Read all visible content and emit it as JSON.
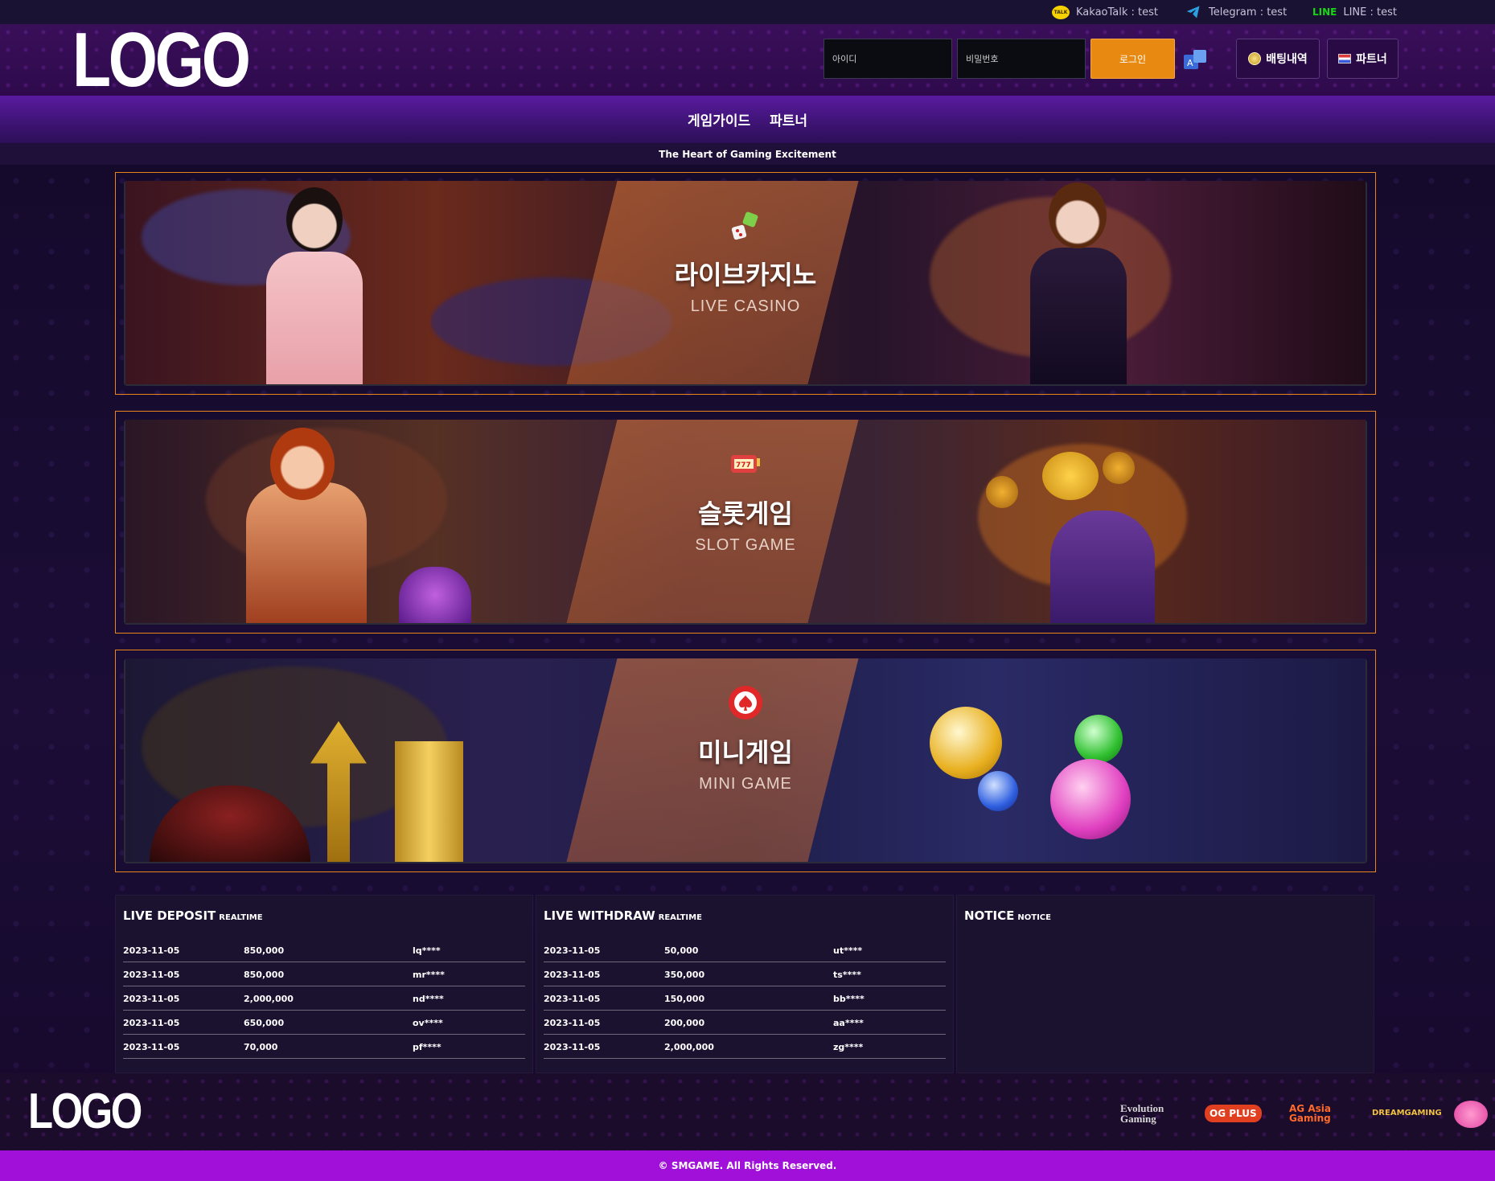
{
  "contacts": {
    "kakao": "KakaoTalk : test",
    "telegram": "Telegram : test",
    "line_brand": "LINE",
    "line": "LINE : test"
  },
  "header": {
    "logo": "LOGO",
    "id_placeholder": "아이디",
    "pw_placeholder": "비밀번호",
    "login_label": "로그인",
    "betting_label": "배팅내역",
    "partner_label": "파트너"
  },
  "nav": {
    "items": [
      "게임가이드",
      "파트너"
    ]
  },
  "tagline": "The Heart of Gaming Excitement",
  "banners": [
    {
      "title": "라이브카지노",
      "subtitle": "LIVE CASINO"
    },
    {
      "title": "슬롯게임",
      "subtitle": "SLOT GAME"
    },
    {
      "title": "미니게임",
      "subtitle": "MINI GAME"
    }
  ],
  "deposit": {
    "title": "LIVE DEPOSIT",
    "tag": "REALTIME",
    "rows": [
      {
        "date": "2023-11-05",
        "amount": "850,000",
        "user": "lq****"
      },
      {
        "date": "2023-11-05",
        "amount": "850,000",
        "user": "mr****"
      },
      {
        "date": "2023-11-05",
        "amount": "2,000,000",
        "user": "nd****"
      },
      {
        "date": "2023-11-05",
        "amount": "650,000",
        "user": "ov****"
      },
      {
        "date": "2023-11-05",
        "amount": "70,000",
        "user": "pf****"
      }
    ]
  },
  "withdraw": {
    "title": "LIVE WITHDRAW",
    "tag": "REALTIME",
    "rows": [
      {
        "date": "2023-11-05",
        "amount": "50,000",
        "user": "ut****"
      },
      {
        "date": "2023-11-05",
        "amount": "350,000",
        "user": "ts****"
      },
      {
        "date": "2023-11-05",
        "amount": "150,000",
        "user": "bb****"
      },
      {
        "date": "2023-11-05",
        "amount": "200,000",
        "user": "aa****"
      },
      {
        "date": "2023-11-05",
        "amount": "2,000,000",
        "user": "zg****"
      }
    ]
  },
  "notice": {
    "title": "NOTICE",
    "tag": "NOTICE"
  },
  "footer": {
    "logo": "LOGO",
    "providers": [
      "Evolution Gaming",
      "OG PLUS",
      "AG Asia Gaming",
      "DREAMGAMING"
    ],
    "copyright": "© SMGAME. All Rights Reserved."
  },
  "colors": {
    "accent": "#e88a12",
    "banner_border": "#e8861a",
    "copyright_bar": "#a010d8",
    "nav": "#4a1688"
  }
}
